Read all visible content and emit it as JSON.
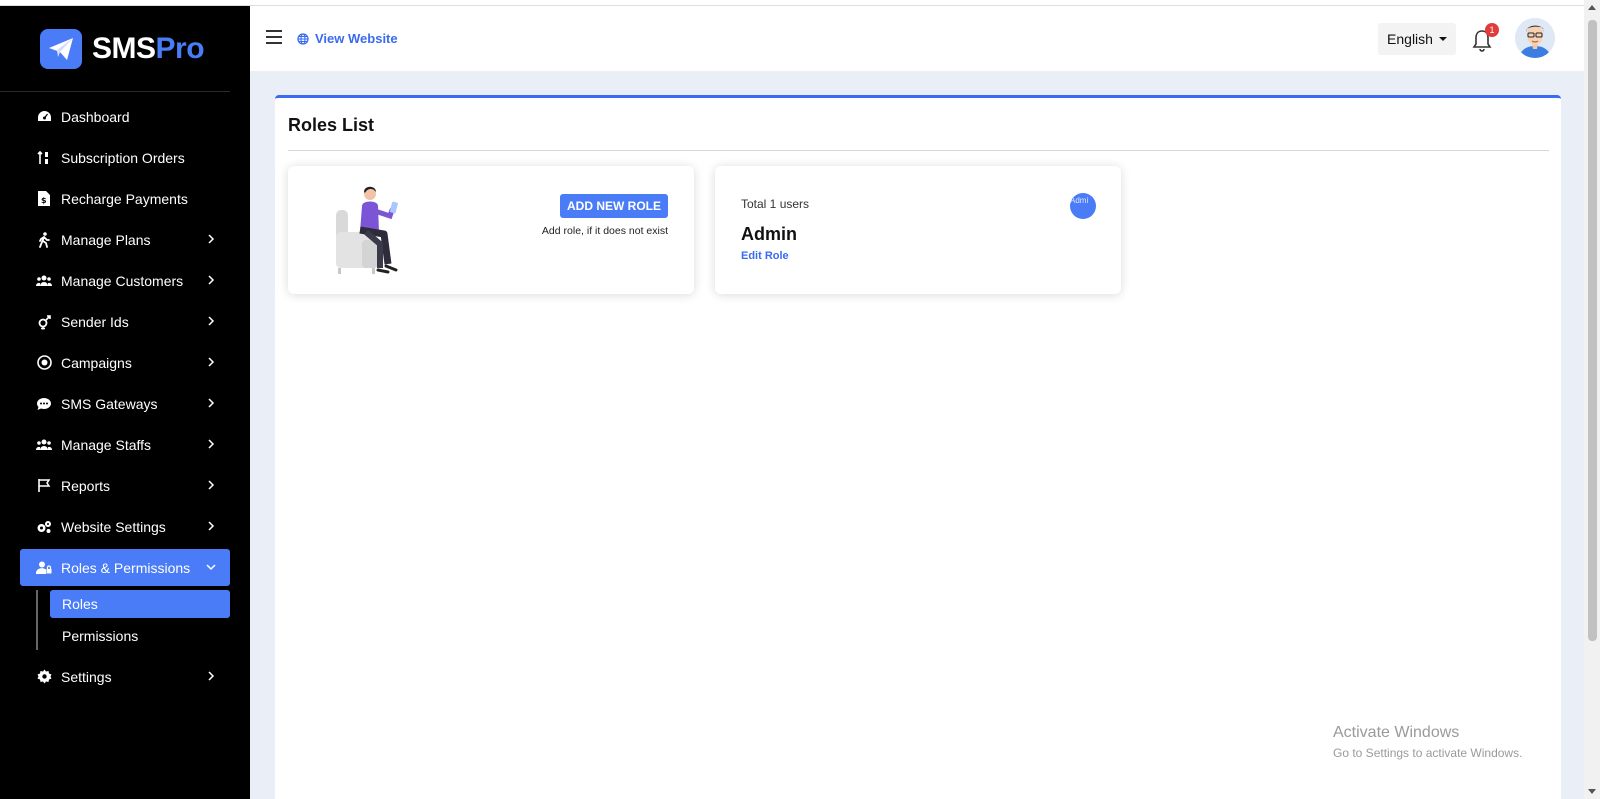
{
  "brand": {
    "part1": "SMS",
    "part2": "Pro"
  },
  "sidebar": {
    "items": [
      {
        "label": "Dashboard",
        "icon": "dashboard-gauge-icon",
        "has_children": false
      },
      {
        "label": "Subscription Orders",
        "icon": "sort-arrows-icon",
        "has_children": false
      },
      {
        "label": "Recharge Payments",
        "icon": "invoice-dollar-icon",
        "has_children": false
      },
      {
        "label": "Manage Plans",
        "icon": "walking-person-icon",
        "has_children": true
      },
      {
        "label": "Manage Customers",
        "icon": "users-icon",
        "has_children": true
      },
      {
        "label": "Sender Ids",
        "icon": "gender-symbol-icon",
        "has_children": true
      },
      {
        "label": "Campaigns",
        "icon": "bullseye-icon",
        "has_children": true
      },
      {
        "label": "SMS Gateways",
        "icon": "sms-bubble-icon",
        "has_children": true
      },
      {
        "label": "Manage Staffs",
        "icon": "staff-group-icon",
        "has_children": true
      },
      {
        "label": "Reports",
        "icon": "flag-icon",
        "has_children": true
      },
      {
        "label": "Website Settings",
        "icon": "gears-icon",
        "has_children": true
      },
      {
        "label": "Roles & Permissions",
        "icon": "user-lock-icon",
        "has_children": true,
        "expanded": true
      },
      {
        "label": "Settings",
        "icon": "gear-icon",
        "has_children": true
      }
    ],
    "submenu": [
      {
        "label": "Roles",
        "active": true
      },
      {
        "label": "Permissions",
        "active": false
      }
    ]
  },
  "header": {
    "view_website": "View Website",
    "language": "English",
    "notification_count": "1"
  },
  "main": {
    "title": "Roles List",
    "add_card": {
      "button": "ADD NEW ROLE",
      "hint": "Add role, if it does not exist"
    },
    "role_card": {
      "total_users": "Total 1 users",
      "avatar_text": "Admi",
      "role_name": "Admin",
      "edit_label": "Edit Role"
    }
  },
  "watermark": {
    "title": "Activate Windows",
    "subtitle": "Go to Settings to activate Windows."
  },
  "colors": {
    "accent": "#4a7cf7",
    "sidebar_bg": "#000000",
    "badge": "#e23b3b"
  }
}
